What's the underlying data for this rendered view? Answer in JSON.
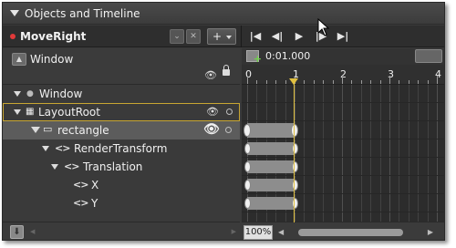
{
  "panel": {
    "title": "Objects and Timeline"
  },
  "storyboard": {
    "name": "MoveRight",
    "add_label": "+"
  },
  "playback": {
    "first": "|◀",
    "prev": "◀|",
    "play": "▶",
    "next": "|▶",
    "last": "▶|"
  },
  "scope": {
    "label": "Window"
  },
  "tree": [
    {
      "label": "Window"
    },
    {
      "label": "LayoutRoot"
    },
    {
      "label": "rectangle"
    },
    {
      "label": "RenderTransform"
    },
    {
      "label": "Translation"
    },
    {
      "label": "X"
    },
    {
      "label": "Y"
    }
  ],
  "timeline": {
    "timecode": "0:01.000",
    "ruler_labels": [
      "0",
      "1",
      "2",
      "3",
      "4"
    ],
    "zoom": "100%",
    "playhead_seconds": 1.0,
    "keyframe_times": [
      0,
      1
    ]
  },
  "colors": {
    "accent": "#c8a632",
    "record": "#e23a3a",
    "playhead": "#e0c040",
    "panel_bg": "#3a3a3a"
  }
}
